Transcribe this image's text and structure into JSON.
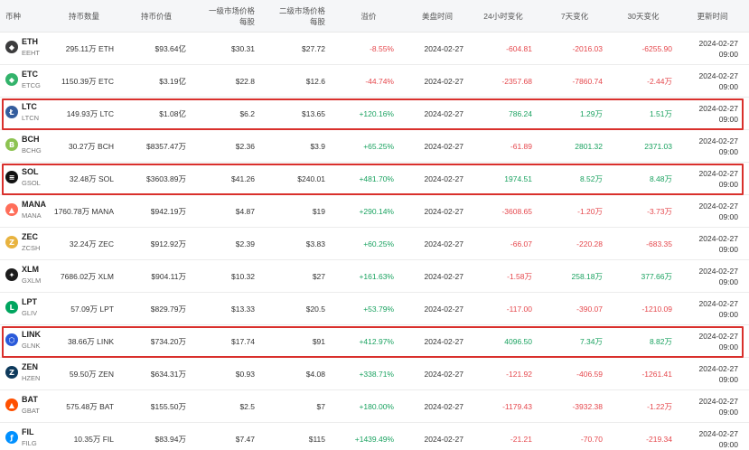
{
  "headers": {
    "coin": "币种",
    "holdings": "持币数量",
    "value": "持币价值",
    "primary_line1": "一级市场价格",
    "primary_line2": "每股",
    "secondary_line1": "二级市场价格",
    "secondary_line2": "每股",
    "premium": "溢价",
    "us_close": "美盘时间",
    "chg24h": "24小时变化",
    "chg7d": "7天变化",
    "chg30d": "30天变化",
    "updated": "更新时间"
  },
  "rows": [
    {
      "symbol": "ETH",
      "ticker": "EEHT",
      "icon": "eth-icon",
      "icon_color": "#3c3c3d",
      "icon_glyph": "◆",
      "holdings": "295.11万 ETH",
      "value": "$93.64亿",
      "primary": "$30.31",
      "secondary": "$27.72",
      "premium": "-8.55%",
      "premium_dir": "neg",
      "date": "2024-02-27",
      "chg24h": "-604.81",
      "chg24h_dir": "neg",
      "chg7d": "-2016.03",
      "chg7d_dir": "neg",
      "chg30d": "-6255.90",
      "chg30d_dir": "neg",
      "updated_date": "2024-02-27",
      "updated_time": "09:00"
    },
    {
      "symbol": "ETC",
      "ticker": "ETCG",
      "icon": "etc-icon",
      "icon_color": "#33b36b",
      "icon_glyph": "◆",
      "holdings": "1150.39万 ETC",
      "value": "$3.19亿",
      "primary": "$22.8",
      "secondary": "$12.6",
      "premium": "-44.74%",
      "premium_dir": "neg",
      "date": "2024-02-27",
      "chg24h": "-2357.68",
      "chg24h_dir": "neg",
      "chg7d": "-7860.74",
      "chg7d_dir": "neg",
      "chg30d": "-2.44万",
      "chg30d_dir": "neg",
      "updated_date": "2024-02-27",
      "updated_time": "09:00"
    },
    {
      "symbol": "LTC",
      "ticker": "LTCN",
      "icon": "ltc-icon",
      "icon_color": "#345d9d",
      "icon_glyph": "Ł",
      "holdings": "149.93万 LTC",
      "value": "$1.08亿",
      "primary": "$6.2",
      "secondary": "$13.65",
      "premium": "+120.16%",
      "premium_dir": "pos",
      "date": "2024-02-27",
      "chg24h": "786.24",
      "chg24h_dir": "pos",
      "chg7d": "1.29万",
      "chg7d_dir": "pos",
      "chg30d": "1.51万",
      "chg30d_dir": "pos",
      "updated_date": "2024-02-27",
      "updated_time": "09:00"
    },
    {
      "symbol": "BCH",
      "ticker": "BCHG",
      "icon": "bch-icon",
      "icon_color": "#8dc351",
      "icon_glyph": "B",
      "holdings": "30.27万 BCH",
      "value": "$8357.47万",
      "primary": "$2.36",
      "secondary": "$3.9",
      "premium": "+65.25%",
      "premium_dir": "pos",
      "date": "2024-02-27",
      "chg24h": "-61.89",
      "chg24h_dir": "neg",
      "chg7d": "2801.32",
      "chg7d_dir": "pos",
      "chg30d": "2371.03",
      "chg30d_dir": "pos",
      "updated_date": "2024-02-27",
      "updated_time": "09:00"
    },
    {
      "symbol": "SOL",
      "ticker": "GSOL",
      "icon": "sol-icon",
      "icon_color": "#111111",
      "icon_glyph": "≡",
      "holdings": "32.48万 SOL",
      "value": "$3603.89万",
      "primary": "$41.26",
      "secondary": "$240.01",
      "premium": "+481.70%",
      "premium_dir": "pos",
      "date": "2024-02-27",
      "chg24h": "1974.51",
      "chg24h_dir": "pos",
      "chg7d": "8.52万",
      "chg7d_dir": "pos",
      "chg30d": "8.48万",
      "chg30d_dir": "pos",
      "updated_date": "2024-02-27",
      "updated_time": "09:00"
    },
    {
      "symbol": "MANA",
      "ticker": "MANA",
      "icon": "mana-icon",
      "icon_color": "#ff6e5a",
      "icon_glyph": "▲",
      "holdings": "1760.78万 MANA",
      "value": "$942.19万",
      "primary": "$4.87",
      "secondary": "$19",
      "premium": "+290.14%",
      "premium_dir": "pos",
      "date": "2024-02-27",
      "chg24h": "-3608.65",
      "chg24h_dir": "neg",
      "chg7d": "-1.20万",
      "chg7d_dir": "neg",
      "chg30d": "-3.73万",
      "chg30d_dir": "neg",
      "updated_date": "2024-02-27",
      "updated_time": "09:00"
    },
    {
      "symbol": "ZEC",
      "ticker": "ZCSH",
      "icon": "zec-icon",
      "icon_color": "#e8b33f",
      "icon_glyph": "Z",
      "holdings": "32.24万 ZEC",
      "value": "$912.92万",
      "primary": "$2.39",
      "secondary": "$3.83",
      "premium": "+60.25%",
      "premium_dir": "pos",
      "date": "2024-02-27",
      "chg24h": "-66.07",
      "chg24h_dir": "neg",
      "chg7d": "-220.28",
      "chg7d_dir": "neg",
      "chg30d": "-683.35",
      "chg30d_dir": "neg",
      "updated_date": "2024-02-27",
      "updated_time": "09:00"
    },
    {
      "symbol": "XLM",
      "ticker": "GXLM",
      "icon": "xlm-icon",
      "icon_color": "#1c1c1c",
      "icon_glyph": "✦",
      "holdings": "7686.02万 XLM",
      "value": "$904.11万",
      "primary": "$10.32",
      "secondary": "$27",
      "premium": "+161.63%",
      "premium_dir": "pos",
      "date": "2024-02-27",
      "chg24h": "-1.58万",
      "chg24h_dir": "neg",
      "chg7d": "258.18万",
      "chg7d_dir": "pos",
      "chg30d": "377.66万",
      "chg30d_dir": "pos",
      "updated_date": "2024-02-27",
      "updated_time": "09:00"
    },
    {
      "symbol": "LPT",
      "ticker": "GLIV",
      "icon": "lpt-icon",
      "icon_color": "#00a55f",
      "icon_glyph": "L",
      "holdings": "57.09万 LPT",
      "value": "$829.79万",
      "primary": "$13.33",
      "secondary": "$20.5",
      "premium": "+53.79%",
      "premium_dir": "pos",
      "date": "2024-02-27",
      "chg24h": "-117.00",
      "chg24h_dir": "neg",
      "chg7d": "-390.07",
      "chg7d_dir": "neg",
      "chg30d": "-1210.09",
      "chg30d_dir": "neg",
      "updated_date": "2024-02-27",
      "updated_time": "09:00"
    },
    {
      "symbol": "LINK",
      "ticker": "GLNK",
      "icon": "link-icon",
      "icon_color": "#2a5ada",
      "icon_glyph": "⬡",
      "holdings": "38.66万 LINK",
      "value": "$734.20万",
      "primary": "$17.74",
      "secondary": "$91",
      "premium": "+412.97%",
      "premium_dir": "pos",
      "date": "2024-02-27",
      "chg24h": "4096.50",
      "chg24h_dir": "pos",
      "chg7d": "7.34万",
      "chg7d_dir": "pos",
      "chg30d": "8.82万",
      "chg30d_dir": "pos",
      "updated_date": "2024-02-27",
      "updated_time": "09:00"
    },
    {
      "symbol": "ZEN",
      "ticker": "HZEN",
      "icon": "zen-icon",
      "icon_color": "#0e3a5c",
      "icon_glyph": "Z",
      "holdings": "59.50万 ZEN",
      "value": "$634.31万",
      "primary": "$0.93",
      "secondary": "$4.08",
      "premium": "+338.71%",
      "premium_dir": "pos",
      "date": "2024-02-27",
      "chg24h": "-121.92",
      "chg24h_dir": "neg",
      "chg7d": "-406.59",
      "chg7d_dir": "neg",
      "chg30d": "-1261.41",
      "chg30d_dir": "neg",
      "updated_date": "2024-02-27",
      "updated_time": "09:00"
    },
    {
      "symbol": "BAT",
      "ticker": "GBAT",
      "icon": "bat-icon",
      "icon_color": "#ff5000",
      "icon_glyph": "▲",
      "holdings": "575.48万 BAT",
      "value": "$155.50万",
      "primary": "$2.5",
      "secondary": "$7",
      "premium": "+180.00%",
      "premium_dir": "pos",
      "date": "2024-02-27",
      "chg24h": "-1179.43",
      "chg24h_dir": "neg",
      "chg7d": "-3932.38",
      "chg7d_dir": "neg",
      "chg30d": "-1.22万",
      "chg30d_dir": "neg",
      "updated_date": "2024-02-27",
      "updated_time": "09:00"
    },
    {
      "symbol": "FIL",
      "ticker": "FILG",
      "icon": "fil-icon",
      "icon_color": "#0090ff",
      "icon_glyph": "ƒ",
      "holdings": "10.35万 FIL",
      "value": "$83.94万",
      "primary": "$7.47",
      "secondary": "$115",
      "premium": "+1439.49%",
      "premium_dir": "pos",
      "date": "2024-02-27",
      "chg24h": "-21.21",
      "chg24h_dir": "neg",
      "chg7d": "-70.70",
      "chg7d_dir": "neg",
      "chg30d": "-219.34",
      "chg30d_dir": "neg",
      "updated_date": "2024-02-27",
      "updated_time": "09:00"
    }
  ],
  "highlighted_rows": [
    2,
    4,
    9
  ],
  "colors": {
    "positive": "#1aa260",
    "negative": "#e5484d",
    "highlight": "#d9302c"
  }
}
